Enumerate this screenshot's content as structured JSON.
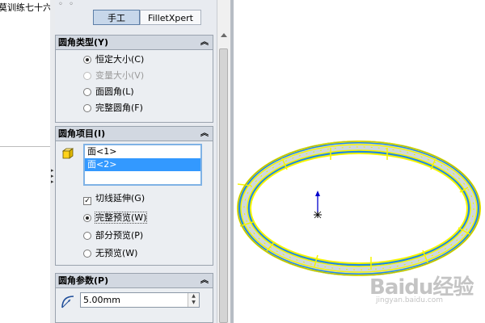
{
  "tree": {
    "title": "莫训练七十六"
  },
  "tabs": {
    "manual": "手工",
    "xpert": "FilletXpert"
  },
  "fillet_type": {
    "title": "圆角类型(Y)",
    "options": [
      {
        "label": "恒定大小(C)",
        "selected": true,
        "enabled": true
      },
      {
        "label": "变量大小(V)",
        "selected": false,
        "enabled": false
      },
      {
        "label": "面圆角(L)",
        "selected": false,
        "enabled": true
      },
      {
        "label": "完整圆角(F)",
        "selected": false,
        "enabled": true
      }
    ]
  },
  "fillet_items": {
    "title": "圆角项目(I)",
    "list": [
      "面<1>",
      "面<2>"
    ],
    "selected_index": 1,
    "tangent_propagation": {
      "label": "切线延伸(G)",
      "checked": true
    },
    "preview": [
      {
        "label": "完整预览(W)",
        "selected": true
      },
      {
        "label": "部分预览(P)",
        "selected": false
      },
      {
        "label": "无预览(W)",
        "selected": false
      }
    ]
  },
  "fillet_params": {
    "title": "圆角参数(P)",
    "radius": "5.00mm"
  },
  "watermark": {
    "logo": "Baidu经验",
    "url": "jingyan.baidu.com"
  },
  "colors": {
    "selection": "#3399ff",
    "ring_edge": "#f5f500",
    "ring_body": "#1e90ff",
    "header": "#d2d8e1"
  },
  "icons": [
    "collapse-chevron-icon",
    "face-icon",
    "fillet-radius-icon",
    "spin-up-icon",
    "spin-down-icon",
    "triad-icon"
  ]
}
